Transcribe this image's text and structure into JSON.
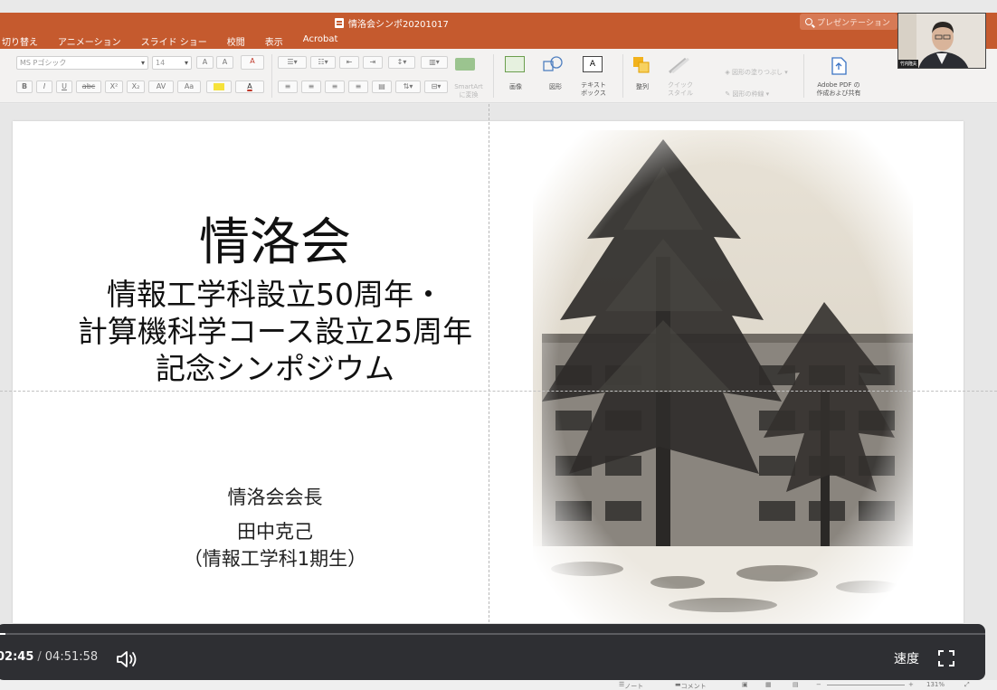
{
  "window": {
    "title": "情洛会シンポ20201017",
    "search_placeholder": "プレゼンテーション"
  },
  "ribbon_tabs": [
    "切り替え",
    "アニメーション",
    "スライド ショー",
    "校閲",
    "表示",
    "Acrobat"
  ],
  "ribbon": {
    "font_name": "MS Pゴシック",
    "font_size": "14",
    "font_grow": "A",
    "font_shrink": "A",
    "bold": "B",
    "italic": "I",
    "underline": "U",
    "strikethrough": "abc",
    "superscript": "X²",
    "subscript": "X₂",
    "char_spacing": "AV",
    "change_case": "Aa",
    "smartart_label": "SmartArt\nに変換",
    "picture_label": "画像",
    "shapes_label": "図形",
    "textbox_label": "テキスト\nボックス",
    "arrange_label": "整列",
    "quick_styles_label": "クイック\nスタイル",
    "shape_fill_label": "図形の塗りつぶし",
    "shape_outline_label": "図形の枠線",
    "adobe_label": "Adobe PDF の\n作成および共有"
  },
  "slide": {
    "title_line1": "情洛会",
    "title_line2": "情報工学科設立50周年・",
    "title_line3": "計算機科学コース設立25周年",
    "title_line4": "記念シンポジウム",
    "presenter_role": "情洛会会長",
    "presenter_name": "田中克己",
    "presenter_affiliation": "（情報工学科1期生）"
  },
  "webcam": {
    "name_tag": "竹内隆夫"
  },
  "player": {
    "current_time": "02:45",
    "separator": "/",
    "total_time": "04:51:58",
    "speed_label": "速度",
    "progress_fraction": 0.009
  },
  "statusbar": {
    "notes": "ノート",
    "comments": "コメント",
    "zoom": "131%"
  },
  "colors": {
    "accent": "#c55a2e",
    "player_bg": "#2e2f33"
  }
}
